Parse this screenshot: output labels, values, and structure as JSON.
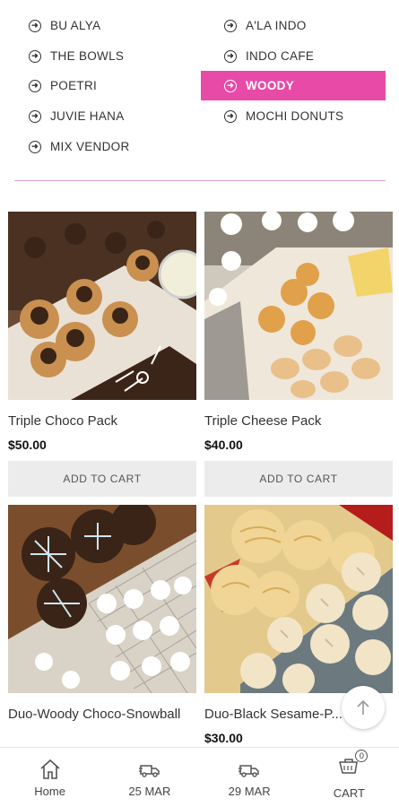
{
  "vendors": {
    "left": [
      {
        "label": "BU ALYA"
      },
      {
        "label": "THE BOWLS"
      },
      {
        "label": "POETRI"
      },
      {
        "label": "JUVIE HANA"
      },
      {
        "label": "MIX VENDOR"
      }
    ],
    "right": [
      {
        "label": "A'LA INDO"
      },
      {
        "label": "INDO CAFE"
      },
      {
        "label": "WOODY",
        "active": true
      },
      {
        "label": "MOCHI DONUTS"
      }
    ],
    "accent_color": "#e84aa8"
  },
  "products": [
    {
      "name": "Triple Choco Pack",
      "price": "$50.00",
      "button": "ADD TO CART"
    },
    {
      "name": "Triple Cheese Pack",
      "price": "$40.00",
      "button": "ADD TO CART"
    },
    {
      "name": "Duo-Woody Choco-Snowball",
      "price": ""
    },
    {
      "name": "Duo-Black Sesame-P...",
      "price": "$30.00"
    }
  ],
  "bottom_nav": [
    {
      "label": "Home",
      "icon": "home-icon"
    },
    {
      "label": "25 MAR",
      "icon": "delivery-truck-icon"
    },
    {
      "label": "29 MAR",
      "icon": "delivery-truck-icon"
    },
    {
      "label": "CART",
      "icon": "cart-icon",
      "badge": "0"
    }
  ]
}
